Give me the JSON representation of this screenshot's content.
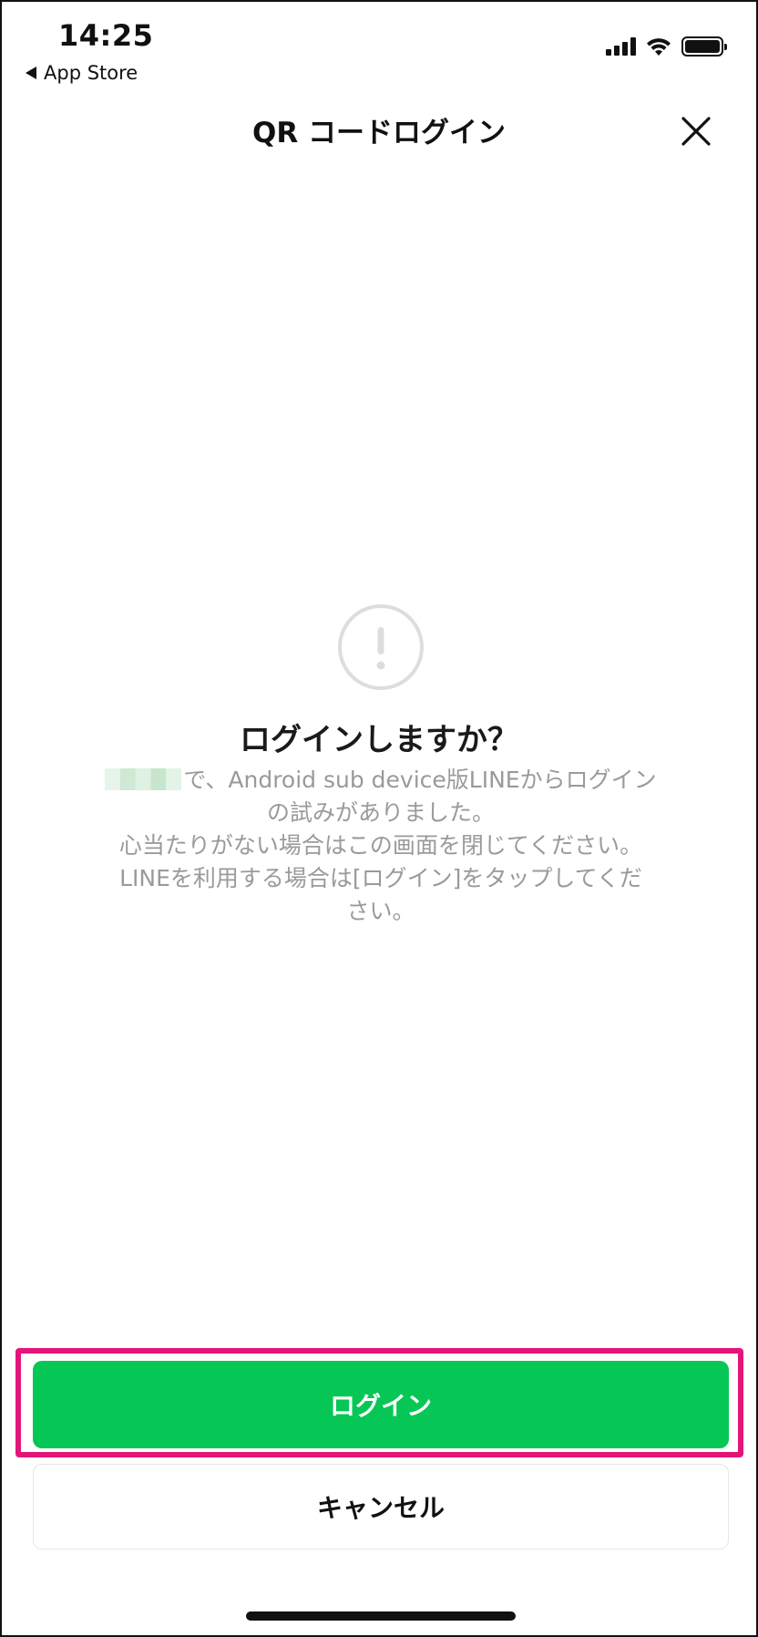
{
  "status_bar": {
    "time": "14:25",
    "back_app": "App Store",
    "icons": [
      "cellular-signal-icon",
      "wifi-icon",
      "battery-icon"
    ]
  },
  "header": {
    "title": "QR コードログイン",
    "close_icon": "close-icon"
  },
  "dialog": {
    "icon": "exclamation-circle-icon",
    "title": "ログインしますか？",
    "message_line1": "で、Android sub device版LINEからログイン",
    "message_line2": "の試みがありました。",
    "message_line3": "心当たりがない場合はこの画面を閉じてください。",
    "message_line4": "LINEを利用する場合は[ログイン]をタップしてくだ",
    "message_line5": "さい。"
  },
  "actions": {
    "login_label": "ログイン",
    "cancel_label": "キャンセル"
  },
  "colors": {
    "primary_green": "#06c755",
    "highlight_pink": "#e4157a",
    "message_gray": "#9a9a9a"
  }
}
